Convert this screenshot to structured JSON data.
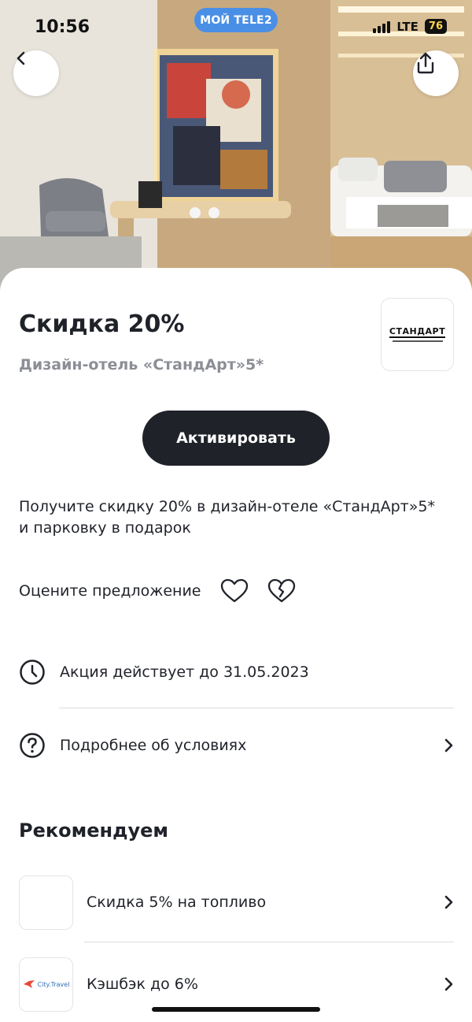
{
  "status_bar": {
    "time": "10:56",
    "operator_pill": "МОЙ TELE2",
    "network": "LTE",
    "battery": "76"
  },
  "hero": {
    "back_icon": "chevron-left-icon",
    "share_icon": "share-icon"
  },
  "offer": {
    "title": "Скидка 20%",
    "partner": "Дизайн-отель «СтандАрт»5*",
    "logo_text": "СТАНДАРТ",
    "activate_label": "Активировать",
    "description": "Получите скидку 20% в дизайн-отеле «СтандАрт»5* и парковку в подарок"
  },
  "rating": {
    "label": "Оцените предложение",
    "like_icon": "heart-icon",
    "dislike_icon": "broken-heart-icon"
  },
  "details": [
    {
      "icon": "clock-icon",
      "text": "Акция действует до 31.05.2023"
    },
    {
      "icon": "question-icon",
      "text": "Подробнее об условиях"
    }
  ],
  "recommend": {
    "title": "Рекомендуем",
    "items": [
      {
        "label": "Скидка 5% на топливо",
        "logo": ""
      },
      {
        "label": "Кэшбэк до 6%",
        "logo": "City.Travel"
      }
    ]
  },
  "colors": {
    "primary_dark": "#1f2229",
    "muted_text": "#8b8e95",
    "pill_blue": "#4a8fe6",
    "divider": "#dcdde0"
  }
}
